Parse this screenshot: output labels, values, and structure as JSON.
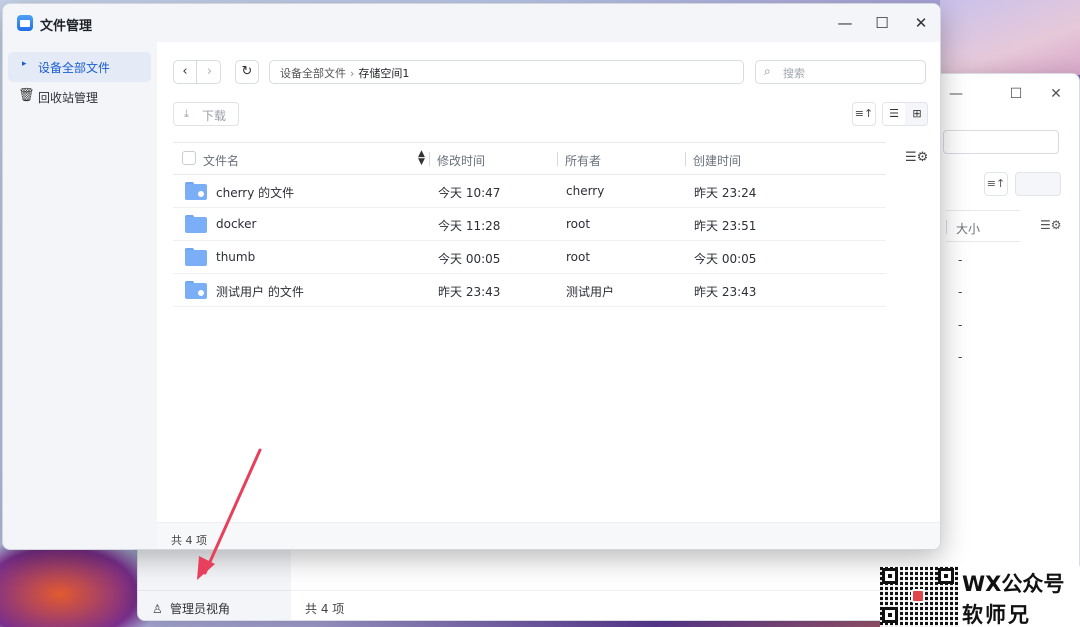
{
  "app": {
    "title": "文件管理"
  },
  "window_controls": {
    "minimize": "—",
    "maximize": "☐",
    "close": "✕"
  },
  "sidebar": {
    "items": [
      {
        "label": "设备全部文件",
        "active": true
      },
      {
        "label": "回收站管理",
        "active": false
      }
    ]
  },
  "toolbar": {
    "breadcrumb": [
      "设备全部文件",
      "存储空间1"
    ],
    "breadcrumb_separator": "›",
    "search_placeholder": "搜索",
    "download_label": "下载"
  },
  "table": {
    "columns": [
      "文件名",
      "修改时间",
      "所有者",
      "创建时间"
    ],
    "rows": [
      {
        "name": "cherry 的文件",
        "modified": "今天 10:47",
        "owner": "cherry",
        "created": "昨天 23:24",
        "user_folder": true
      },
      {
        "name": "docker",
        "modified": "今天 11:28",
        "owner": "root",
        "created": "昨天 23:51",
        "user_folder": false
      },
      {
        "name": "thumb",
        "modified": "今天 00:05",
        "owner": "root",
        "created": "今天 00:05",
        "user_folder": false
      },
      {
        "name": "测试用户 的文件",
        "modified": "昨天 23:43",
        "owner": "测试用户",
        "created": "昨天 23:43",
        "user_folder": true
      }
    ]
  },
  "footer": {
    "count": "共 4 项"
  },
  "background_window": {
    "column": "大小",
    "sizes": [
      "-",
      "-",
      "-",
      "-"
    ],
    "footer_count": "共 4 项",
    "admin_view": "管理员视角"
  },
  "watermark": {
    "line1": "WX公众号",
    "line2": "软师兄"
  },
  "colors": {
    "accent": "#1a5fd0",
    "folder": "#7aaef7",
    "arrow": "#e8405c"
  }
}
